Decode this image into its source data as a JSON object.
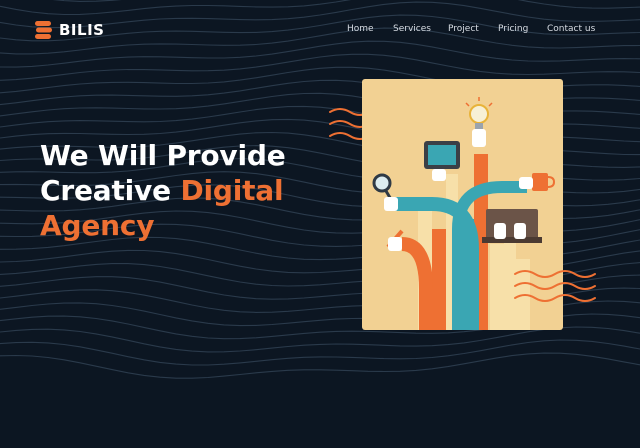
{
  "brand": {
    "name": "BILIS",
    "logo_icon": "stacked-s-logo",
    "accent": "#ee7033"
  },
  "nav": {
    "items": [
      {
        "label": "Home"
      },
      {
        "label": "Services"
      },
      {
        "label": "Project"
      },
      {
        "label": "Pricing"
      },
      {
        "label": "Contact us"
      }
    ]
  },
  "hero": {
    "line1": "We Will Provide",
    "line2_a": "Creative",
    "line2_b": "Digital",
    "line3": "Agency"
  },
  "colors": {
    "background": "#0c1622",
    "accent": "#ee7033",
    "text": "#ffffff",
    "illustration_bg": "#f2d193",
    "teal": "#3aa6b3"
  }
}
